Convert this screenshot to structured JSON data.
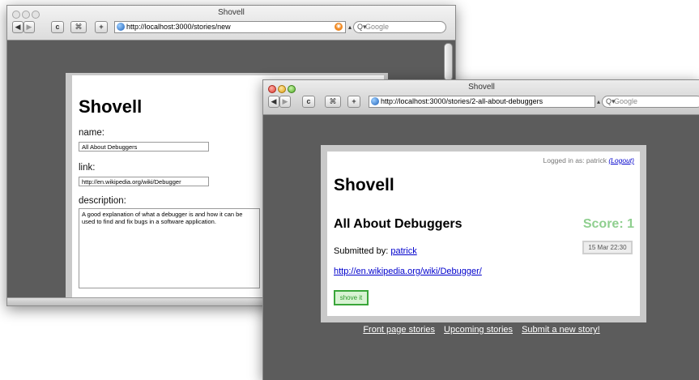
{
  "back_window": {
    "title": "Shovell",
    "url": "http://localhost:3000/stories/new",
    "search_placeholder": "Google",
    "page": {
      "heading": "Shovell",
      "name_label": "name:",
      "name_value": "All About Debuggers",
      "link_label": "link:",
      "link_value": "http://en.wikipedia.org/wiki/Debugger",
      "description_label": "description:",
      "description_value": "A good explanation of what a debugger is and how it can be used to find and fix bugs in a software application."
    }
  },
  "front_window": {
    "title": "Shovell",
    "url": "http://localhost:3000/stories/2-all-about-debuggers",
    "search_placeholder": "Google",
    "page": {
      "logged_in_text": "Logged in as: patrick",
      "logout_link": "(Logout)",
      "heading": "Shovell",
      "story_title": "All About Debuggers",
      "score": "Score: 1",
      "date": "15 Mar 22:30",
      "submitted_by_label": "Submitted by:",
      "submitted_by_user": "patrick",
      "story_link": "http://en.wikipedia.org/wiki/Debugger/",
      "shove_button": "shove it",
      "footer_links": [
        "Front page stories",
        "Upcoming stories",
        "Submit a new story!"
      ]
    }
  },
  "toolbar": {
    "back_glyph": "◀",
    "forward_glyph": "▶",
    "reload_glyph": "c",
    "bookmark_glyph": "⌘",
    "add_glyph": "+"
  },
  "icons": {
    "globe": "globe-icon",
    "rss": "rss-icon",
    "search": "search-icon"
  },
  "colors": {
    "score_green": "#8fcf8f",
    "button_green": "#3aa63a",
    "link_blue": "#0000cc",
    "content_gray": "#5c5c5c"
  }
}
